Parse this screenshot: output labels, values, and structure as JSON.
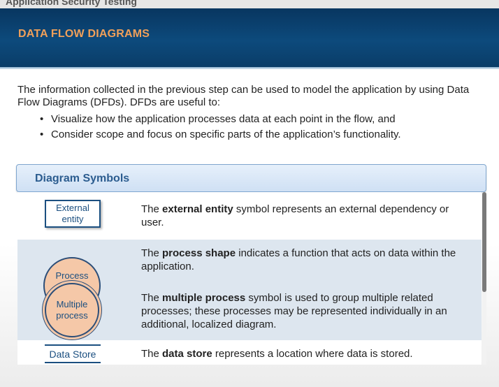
{
  "window": {
    "title": "Application Security Testing"
  },
  "header": {
    "title": "DATA FLOW DIAGRAMS"
  },
  "intro": {
    "paragraph": "The information collected in the previous step can be used to model the application by using Data Flow Diagrams (DFDs). DFDs are useful to:",
    "bullets": [
      "Visualize how the application processes data at each point in the flow, and",
      "Consider scope and focus on specific parts of the application’s functionality."
    ]
  },
  "panel": {
    "title": "Diagram Symbols"
  },
  "symbols": {
    "external_entity": {
      "label": "External entity",
      "pre": "The ",
      "term": "external entity",
      "post": " symbol represents an external dependency or user."
    },
    "process": {
      "label": "Process",
      "pre": "The ",
      "term": "process shape",
      "post": " indicates a function that acts on data within the application."
    },
    "multiple_process": {
      "label": "Multiple process",
      "pre": "The ",
      "term": "multiple process",
      "post": " symbol is used to group multiple related processes; these processes may be represented individually in an additional, localized diagram."
    },
    "data_store": {
      "label": "Data Store",
      "pre": "The ",
      "term": "data store",
      "post": " represents a location where data is stored."
    }
  },
  "colors": {
    "header_bg": "#0d4a7c",
    "header_title": "#f0a05a",
    "panel_title": "#2b5c8f",
    "symbol_stroke": "#1b4f80",
    "process_fill": "#f5c8a8",
    "alt_row": "#dde6ef"
  }
}
